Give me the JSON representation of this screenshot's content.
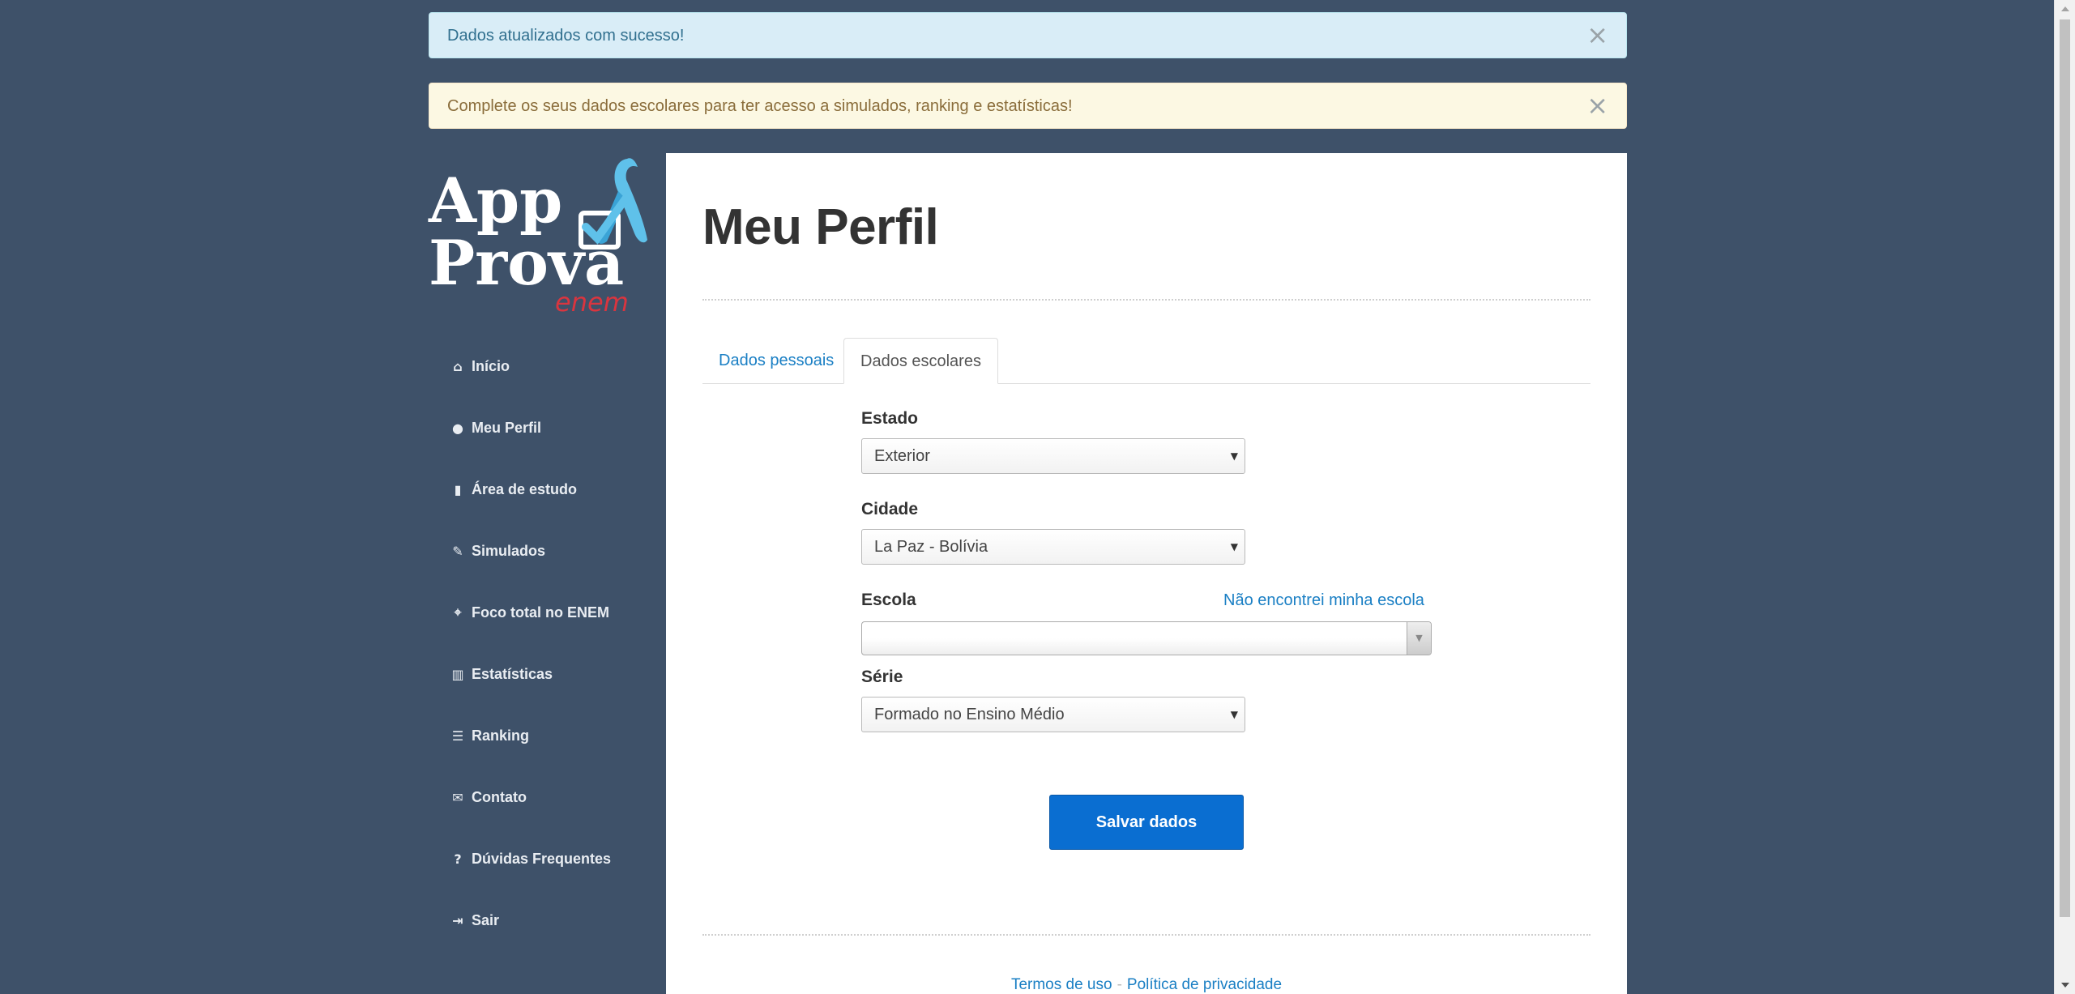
{
  "alerts": {
    "success_text": "Dados atualizados com sucesso!",
    "warning_text": "Complete os seus dados escolares para ter acesso a simulados, ranking e estatísticas!",
    "close_glyph": "×"
  },
  "logo": {
    "line1": "App",
    "line2": "Prova",
    "line3": "enem",
    "colors": {
      "text": "#ffffff",
      "accent": "#d9353f",
      "ribbon": "#5fc1ea"
    }
  },
  "sidebar": {
    "items": [
      {
        "label": "Início",
        "icon": "home-icon",
        "glyph": "⌂"
      },
      {
        "label": "Meu Perfil",
        "icon": "user-icon",
        "glyph": "●"
      },
      {
        "label": "Área de estudo",
        "icon": "book-icon",
        "glyph": "▮"
      },
      {
        "label": "Simulados",
        "icon": "pencil-icon",
        "glyph": "✎"
      },
      {
        "label": "Foco total no ENEM",
        "icon": "crosshairs-icon",
        "glyph": "⌖"
      },
      {
        "label": "Estatísticas",
        "icon": "bar-chart-icon",
        "glyph": "▥"
      },
      {
        "label": "Ranking",
        "icon": "list-ol-icon",
        "glyph": "☰"
      },
      {
        "label": "Contato",
        "icon": "envelope-icon",
        "glyph": "✉"
      },
      {
        "label": "Dúvidas Frequentes",
        "icon": "question-circle-icon",
        "glyph": "?"
      },
      {
        "label": "Sair",
        "icon": "sign-out-icon",
        "glyph": "⇥"
      }
    ]
  },
  "main": {
    "title": "Meu Perfil",
    "tabs": [
      {
        "label": "Dados pessoais",
        "active": false
      },
      {
        "label": "Dados escolares",
        "active": true
      }
    ],
    "form": {
      "estado_label": "Estado",
      "estado_value": "Exterior",
      "cidade_label": "Cidade",
      "cidade_value": "La Paz - Bolívia",
      "escola_label": "Escola",
      "escola_value": "",
      "escola_link": "Não encontrei minha escola",
      "serie_label": "Série",
      "serie_value": "Formado no Ensino Médio",
      "save_label": "Salvar dados"
    },
    "footer": {
      "terms": "Termos de uso",
      "separator": "-",
      "privacy": "Política de privacidade"
    }
  },
  "colors": {
    "background": "#3e5169",
    "primary_button": "#0a6ed1",
    "link": "#1a7fc4"
  }
}
